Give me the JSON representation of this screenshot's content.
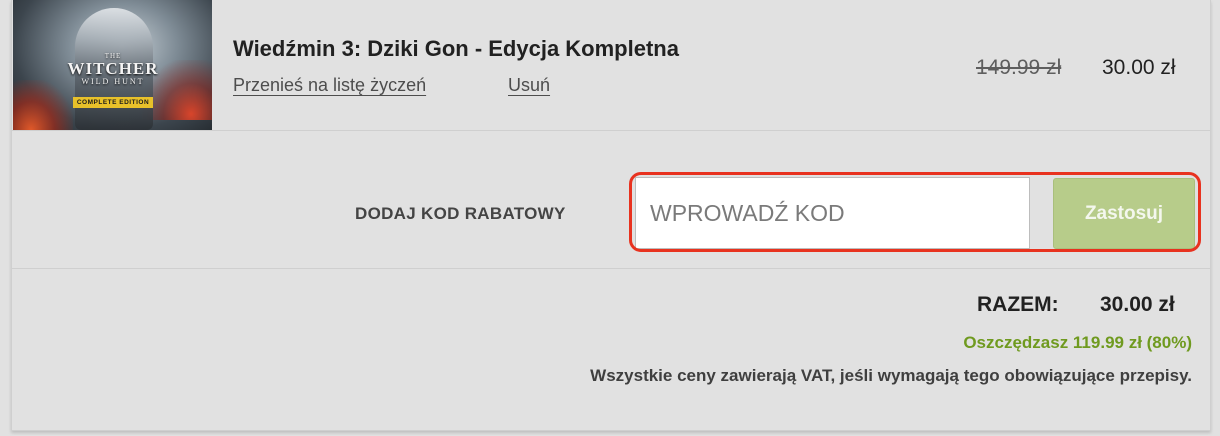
{
  "cart_item": {
    "cover_art": {
      "logo_top": "THE",
      "logo_name": "WITCHER",
      "logo_sub": "WILD HUNT",
      "badge": "COMPLETE EDITION"
    },
    "title": "Wiedźmin 3: Dziki Gon - Edycja Kompletna",
    "move_to_wishlist_label": "Przenieś na listę życzeń",
    "remove_label": "Usuń",
    "original_price": "149.99 zł",
    "discounted_price": "30.00 zł"
  },
  "coupon": {
    "label": "DODAJ KOD RABATOWY",
    "input_placeholder": "WPROWADŹ KOD",
    "input_value": "",
    "apply_label": "Zastosuj"
  },
  "summary": {
    "total_label": "RAZEM:",
    "total_value": "30.00 zł",
    "savings_text": "Oszczędzasz 119.99 zł (80%)",
    "vat_note": "Wszystkie ceny zawierają VAT, jeśli wymagają tego obowiązujące przepisy."
  },
  "colors": {
    "highlight_border": "#e8321f",
    "apply_button": "#b7cc8a",
    "savings_text": "#6f9a1f",
    "background": "#e1e1e1"
  }
}
